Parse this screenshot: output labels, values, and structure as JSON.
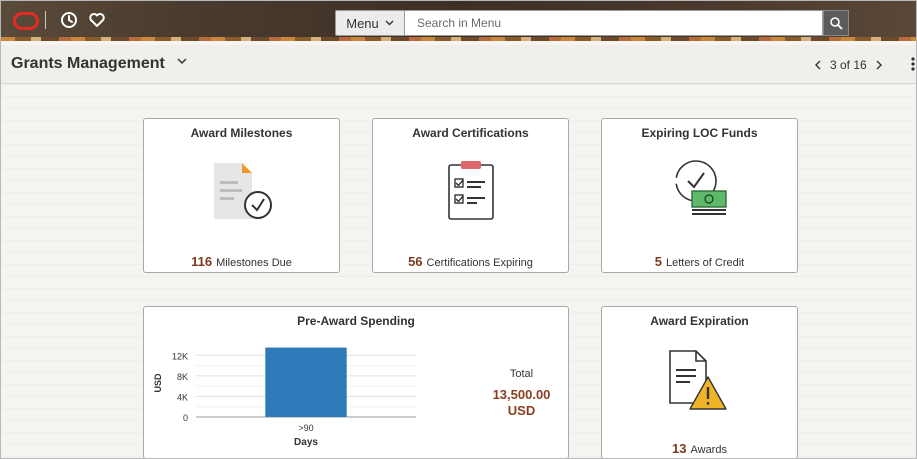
{
  "header": {
    "menu_label": "Menu",
    "search_placeholder": "Search in Menu"
  },
  "titlebar": {
    "title": "Grants Management",
    "pager_text": "3 of 16"
  },
  "tiles": [
    {
      "title": "Award Milestones",
      "count": "116",
      "caption": "Milestones Due"
    },
    {
      "title": "Award Certifications",
      "count": "56",
      "caption": "Certifications Expiring"
    },
    {
      "title": "Expiring LOC Funds",
      "count": "5",
      "caption": "Letters of Credit"
    },
    {
      "title": "Award Expiration",
      "count": "13",
      "caption": "Awards"
    }
  ],
  "pre_award": {
    "title": "Pre-Award Spending",
    "total_label": "Total",
    "total_value": "13,500.00",
    "total_unit": "USD"
  },
  "chart_data": {
    "type": "bar",
    "categories": [
      ">90"
    ],
    "values": [
      13500
    ],
    "xlabel": "Days",
    "ylabel": "USD",
    "ylim": [
      0,
      14000
    ],
    "yticks": [
      0,
      4000,
      8000,
      12000
    ],
    "ytick_labels": [
      "0",
      "4K",
      "8K",
      "12K"
    ],
    "bar_color": "#2e7ab8",
    "grid": true
  },
  "colors": {
    "count_color": "#7a3a1c",
    "oracle_red": "#e32b22"
  }
}
